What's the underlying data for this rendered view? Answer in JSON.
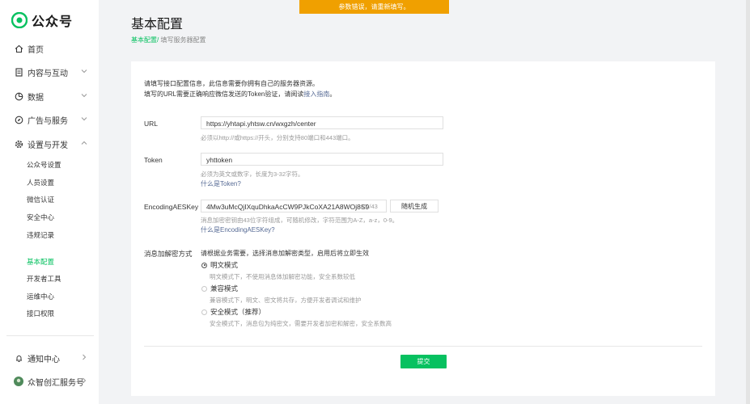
{
  "notice": {
    "text": "参数错误，请重新填写。"
  },
  "sidebar": {
    "logo_text": "公众号",
    "items": [
      {
        "label": "首页"
      },
      {
        "label": "内容与互动"
      },
      {
        "label": "数据"
      },
      {
        "label": "广告与服务"
      },
      {
        "label": "设置与开发"
      }
    ],
    "sub_items": [
      {
        "label": "公众号设置"
      },
      {
        "label": "人员设置"
      },
      {
        "label": "微信认证"
      },
      {
        "label": "安全中心"
      },
      {
        "label": "违规记录"
      },
      {
        "label": "基本配置"
      },
      {
        "label": "开发者工具"
      },
      {
        "label": "运维中心"
      },
      {
        "label": "接口权限"
      }
    ],
    "bottom_items": [
      {
        "label": "通知中心"
      },
      {
        "label": "众智创汇服务号"
      }
    ]
  },
  "header": {
    "title": "基本配置",
    "breadcrumb_link": "基本配置/",
    "breadcrumb_current": " 填写服务器配置"
  },
  "form": {
    "intro_line1": "请填写接口配置信息，此信息需要你拥有自己的服务器资源。",
    "intro_line2_prefix": "填写的URL需要正确响应微信发送的Token验证，请阅读",
    "intro_link": "接入指南",
    "intro_line2_suffix": "。",
    "url": {
      "label": "URL",
      "value": "https://yhtapi.yhtsw.cn/wxgzh/center",
      "hint": "必须以http://或https://开头，分别支持80端口和443端口。"
    },
    "token": {
      "label": "Token",
      "value": "yhttoken",
      "hint": "必须为英文或数字，长度为3-32字符。",
      "link": "什么是Token?"
    },
    "aeskey": {
      "label": "EncodingAESKey",
      "value": "4Mw3uMcQjIXquDhkaAcCW9PJkCoXA21A8WOj8S9",
      "counter": "43 /43",
      "generate": "随机生成",
      "hint": "消息加密密钥由43位字符组成，可随机修改，字符范围为A-Z，a-z，0-9。",
      "link": "什么是EncodingAESKey?"
    },
    "encrypt": {
      "label": "消息加解密方式",
      "hint": "请根据业务需要，选择消息加解密类型，启用后将立即生效",
      "options": [
        {
          "label": "明文模式",
          "desc": "明文模式下，不使用消息体加解密功能，安全系数较低",
          "checked": true
        },
        {
          "label": "兼容模式",
          "desc": "兼容模式下，明文、密文将共存，方便开发者调试和维护",
          "checked": false
        },
        {
          "label": "安全模式（推荐）",
          "desc": "安全模式下，消息包为纯密文，需要开发者加密和解密，安全系数高",
          "checked": false
        }
      ]
    },
    "submit": "提交"
  }
}
